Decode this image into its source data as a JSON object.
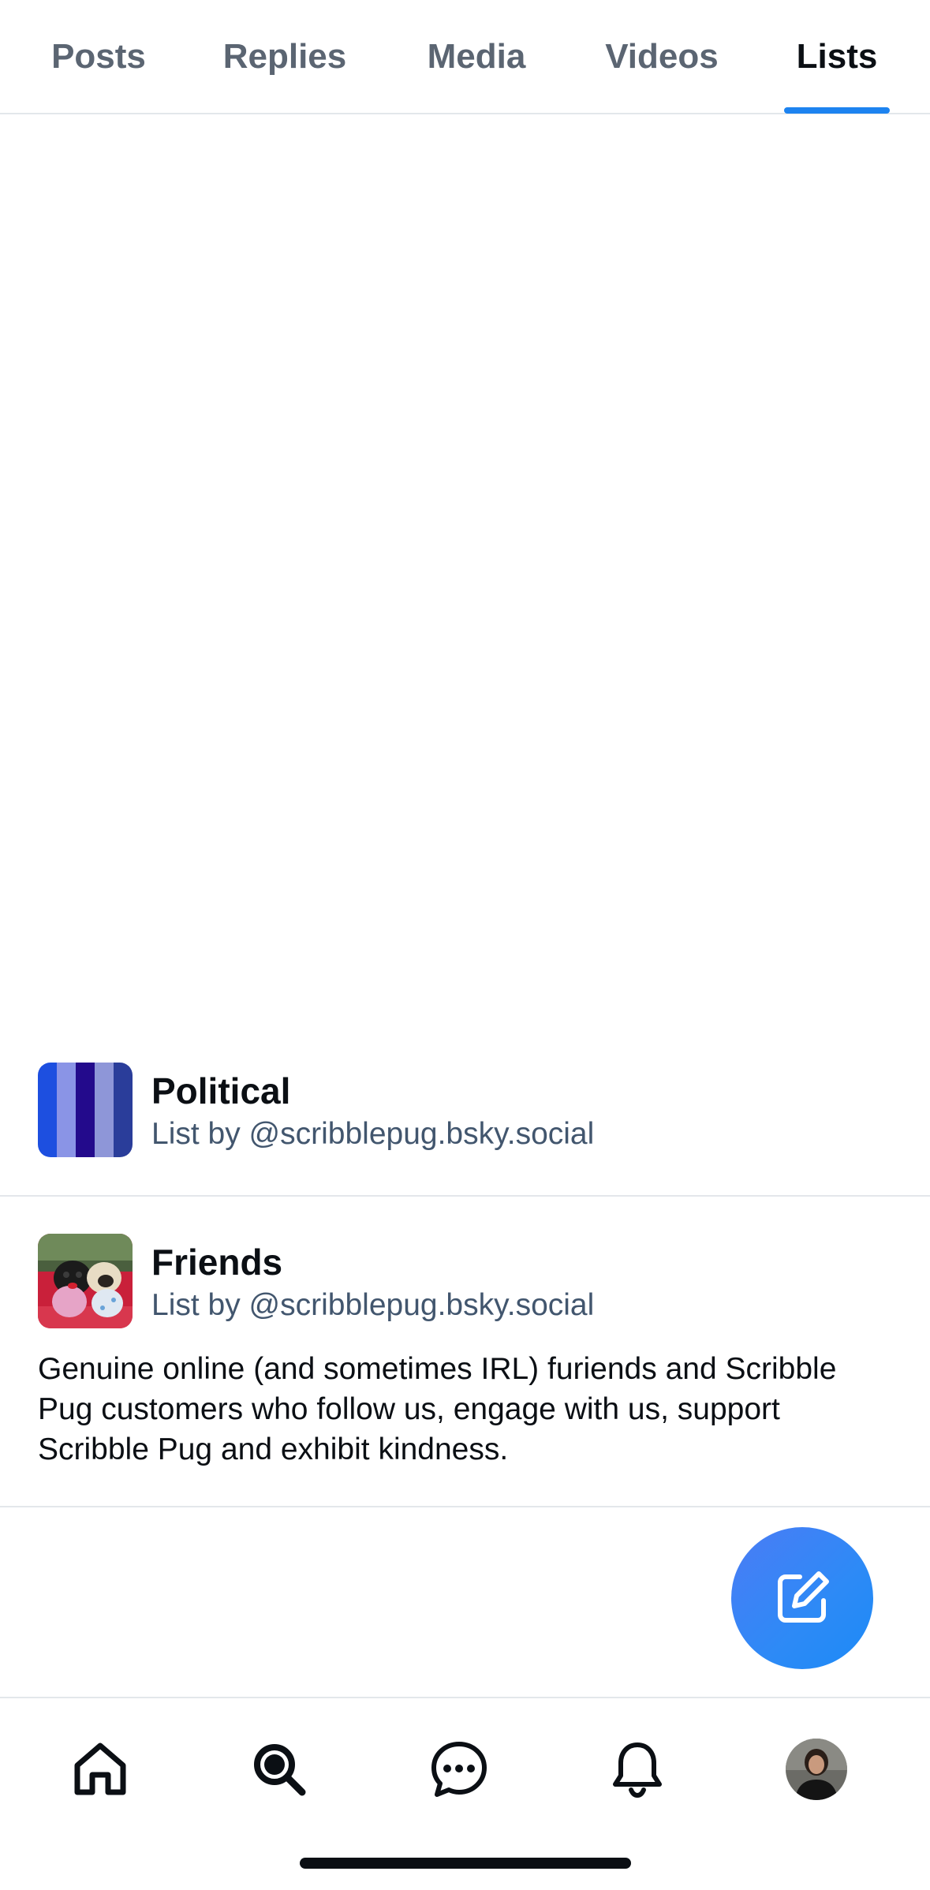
{
  "tabs": [
    {
      "label": "Posts",
      "active": false
    },
    {
      "label": "Replies",
      "active": false
    },
    {
      "label": "Media",
      "active": false
    },
    {
      "label": "Videos",
      "active": false
    },
    {
      "label": "Lists",
      "active": true
    }
  ],
  "lists": [
    {
      "name": "Political",
      "owner": "List by @scribblepug.bsky.social",
      "avatar_icon": "striped-list-avatar"
    },
    {
      "name": "Friends",
      "owner": "List by @scribblepug.bsky.social",
      "description": "Genuine online (and sometimes IRL) furiends and Scribble Pug customers who follow us, engage with us, support Scribble Pug and exhibit kindness.",
      "avatar_icon": "pug-photo-avatar"
    }
  ],
  "fab": {
    "icon": "compose-icon"
  },
  "bottom_nav": [
    {
      "icon": "home-icon"
    },
    {
      "icon": "search-icon"
    },
    {
      "icon": "chat-icon"
    },
    {
      "icon": "bell-icon"
    },
    {
      "icon": "profile-avatar"
    }
  ],
  "colors": {
    "accent": "#1d83f0",
    "secondary_text": "#42566e",
    "divider": "#e3e7eb"
  }
}
